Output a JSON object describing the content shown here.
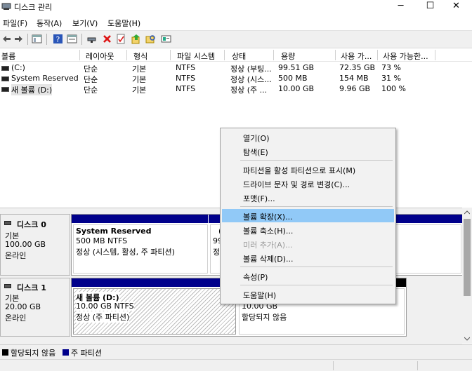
{
  "window": {
    "title": "디스크 관리",
    "minimize": "─",
    "maximize": "☐",
    "close": "✕"
  },
  "menu": [
    "파일(F)",
    "동작(A)",
    "보기(V)",
    "도움말(H)"
  ],
  "columns": [
    "볼륨",
    "레이아웃",
    "형식",
    "파일 시스템",
    "상태",
    "용량",
    "사용 가...",
    "사용 가능한..."
  ],
  "volumes": [
    {
      "name": "(C:)",
      "layout": "단순",
      "type": "기본",
      "fs": "NTFS",
      "status": "정상 (부팅...",
      "capacity": "99.51 GB",
      "free": "72.35 GB",
      "pct": "73 %"
    },
    {
      "name": "System Reserved",
      "layout": "단순",
      "type": "기본",
      "fs": "NTFS",
      "status": "정상 (시스...",
      "capacity": "500 MB",
      "free": "154 MB",
      "pct": "31 %"
    },
    {
      "name": "새 볼륨 (D:)",
      "layout": "단순",
      "type": "기본",
      "fs": "NTFS",
      "status": "정상 (주 ...",
      "capacity": "10.00 GB",
      "free": "9.96 GB",
      "pct": "100 %"
    }
  ],
  "disks": [
    {
      "title": "디스크 0",
      "kind": "기본",
      "size": "100.00 GB",
      "state": "온라인",
      "p1": {
        "name": "System Reserved",
        "line1": "500 MB NTFS",
        "line2": "정상 (시스템, 활성, 주 파티션)"
      },
      "p2": {
        "name": "(",
        "line1": "99",
        "line2": "정"
      }
    },
    {
      "title": "디스크 1",
      "kind": "기본",
      "size": "20.00 GB",
      "state": "온라인",
      "p1": {
        "name": "새 볼륨  (D:)",
        "line1": "10.00 GB NTFS",
        "line2": "정상 (주 파티션)"
      },
      "p2": {
        "line1": "10.00 GB",
        "line2": "할당되지 않음"
      }
    }
  ],
  "legend": {
    "unallocated": "할당되지 않음",
    "primary": "주 파티션"
  },
  "context_menu": [
    "열기(O)",
    "탐색(E)",
    "파티션을 활성 파티션으로 표시(M)",
    "드라이브 문자 및 경로 변경(C)...",
    "포맷(F)...",
    "볼륨 확장(X)...",
    "볼륨 축소(H)...",
    "미러 추가(A)...",
    "볼륨 삭제(D)...",
    "속성(P)",
    "도움말(H)"
  ],
  "colors": {
    "primary_partition": "#00008b",
    "unallocated": "#000000",
    "highlight": "#91c9f7"
  }
}
